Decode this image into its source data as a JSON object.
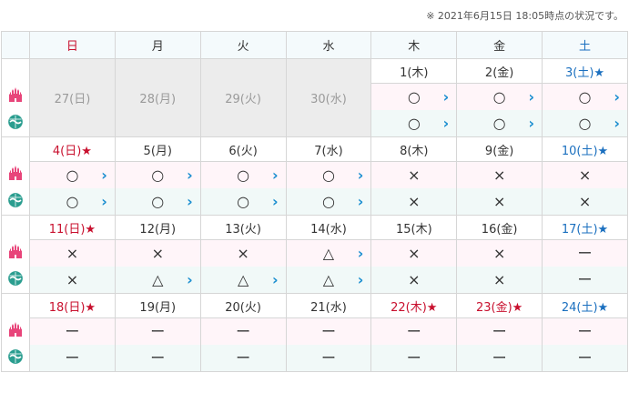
{
  "status_text": "※ 2021年6月15日 18:05時点の状況です。",
  "headers": [
    {
      "label": "日",
      "type": "sun"
    },
    {
      "label": "月",
      "type": "wkd"
    },
    {
      "label": "火",
      "type": "wkd"
    },
    {
      "label": "水",
      "type": "wkd"
    },
    {
      "label": "木",
      "type": "wkd"
    },
    {
      "label": "金",
      "type": "wkd"
    },
    {
      "label": "土",
      "type": "sat"
    }
  ],
  "row_icons": {
    "land": "castle-icon",
    "sea": "globe-icon",
    "land_color": "#e8457a",
    "sea_color": "#2a9d8f"
  },
  "weeks": [
    {
      "days": [
        {
          "date": "27(日)",
          "past": true
        },
        {
          "date": "28(月)",
          "past": true
        },
        {
          "date": "29(火)",
          "past": true
        },
        {
          "date": "30(水)",
          "past": true
        },
        {
          "date": "1(木)",
          "type": "wkd",
          "land": "○",
          "land_link": true,
          "sea": "○",
          "sea_link": true
        },
        {
          "date": "2(金)",
          "type": "wkd",
          "land": "○",
          "land_link": true,
          "sea": "○",
          "sea_link": true
        },
        {
          "date": "3(土)★",
          "type": "sat",
          "land": "○",
          "land_link": true,
          "sea": "○",
          "sea_link": true
        }
      ]
    },
    {
      "days": [
        {
          "date": "4(日)★",
          "type": "sun",
          "land": "○",
          "land_link": true,
          "sea": "○",
          "sea_link": true
        },
        {
          "date": "5(月)",
          "type": "wkd",
          "land": "○",
          "land_link": true,
          "sea": "○",
          "sea_link": true
        },
        {
          "date": "6(火)",
          "type": "wkd",
          "land": "○",
          "land_link": true,
          "sea": "○",
          "sea_link": true
        },
        {
          "date": "7(水)",
          "type": "wkd",
          "land": "○",
          "land_link": true,
          "sea": "○",
          "sea_link": true
        },
        {
          "date": "8(木)",
          "type": "wkd",
          "land": "×",
          "land_link": false,
          "sea": "×",
          "sea_link": false
        },
        {
          "date": "9(金)",
          "type": "wkd",
          "land": "×",
          "land_link": false,
          "sea": "×",
          "sea_link": false
        },
        {
          "date": "10(土)★",
          "type": "sat",
          "land": "×",
          "land_link": false,
          "sea": "×",
          "sea_link": false
        }
      ]
    },
    {
      "days": [
        {
          "date": "11(日)★",
          "type": "sun",
          "land": "×",
          "land_link": false,
          "sea": "×",
          "sea_link": false
        },
        {
          "date": "12(月)",
          "type": "wkd",
          "land": "×",
          "land_link": false,
          "sea": "△",
          "sea_link": true
        },
        {
          "date": "13(火)",
          "type": "wkd",
          "land": "×",
          "land_link": false,
          "sea": "△",
          "sea_link": true
        },
        {
          "date": "14(水)",
          "type": "wkd",
          "land": "△",
          "land_link": true,
          "sea": "△",
          "sea_link": true
        },
        {
          "date": "15(木)",
          "type": "wkd",
          "land": "×",
          "land_link": false,
          "sea": "×",
          "sea_link": false
        },
        {
          "date": "16(金)",
          "type": "wkd",
          "land": "×",
          "land_link": false,
          "sea": "×",
          "sea_link": false
        },
        {
          "date": "17(土)★",
          "type": "sat",
          "land": "ー",
          "land_link": false,
          "sea": "ー",
          "sea_link": false
        }
      ]
    },
    {
      "days": [
        {
          "date": "18(日)★",
          "type": "sun",
          "land": "ー",
          "land_link": false,
          "sea": "ー",
          "sea_link": false
        },
        {
          "date": "19(月)",
          "type": "wkd",
          "land": "ー",
          "land_link": false,
          "sea": "ー",
          "sea_link": false
        },
        {
          "date": "20(火)",
          "type": "wkd",
          "land": "ー",
          "land_link": false,
          "sea": "ー",
          "sea_link": false
        },
        {
          "date": "21(水)",
          "type": "wkd",
          "land": "ー",
          "land_link": false,
          "sea": "ー",
          "sea_link": false
        },
        {
          "date": "22(木)★",
          "type": "hol",
          "land": "ー",
          "land_link": false,
          "sea": "ー",
          "sea_link": false
        },
        {
          "date": "23(金)★",
          "type": "hol",
          "land": "ー",
          "land_link": false,
          "sea": "ー",
          "sea_link": false
        },
        {
          "date": "24(土)★",
          "type": "sat",
          "land": "ー",
          "land_link": false,
          "sea": "ー",
          "sea_link": false
        }
      ]
    }
  ],
  "chevron_glyph": "›"
}
